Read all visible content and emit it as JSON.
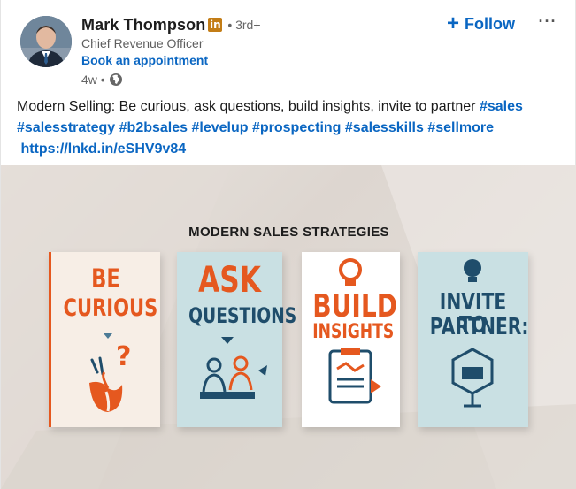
{
  "author": {
    "name": "Mark Thompson",
    "badge": "in",
    "degree": "• 3rd+",
    "headline": "Chief Revenue Officer",
    "cta": "Book an appointment",
    "timestamp": "4w •"
  },
  "actions": {
    "follow_label": "Follow",
    "follow_icon": "+",
    "more_icon": "···"
  },
  "post": {
    "text": "Modern Selling: Be curious, ask questions, build insights, invite to partner ",
    "hashtags": [
      "#sales",
      "#salesstrategy",
      "#b2bsales",
      "#levelup",
      "#prospecting",
      "#salesskills",
      "#sellmore"
    ],
    "link": "https://lnkd.in/eSHV9v84"
  },
  "image": {
    "title": "MODERN SALES STRATEGIES",
    "cards": [
      {
        "line1": "BE",
        "line2": "CURIOUS"
      },
      {
        "line1": "ASK",
        "line2": "QUESTIONS"
      },
      {
        "line1": "BUILD",
        "line2": "INSIGHTS"
      },
      {
        "line1": "INVITE TO",
        "line2": "PARTNER:"
      }
    ],
    "colors": {
      "orange": "#e5581f",
      "navy": "#1f4d6b",
      "card_light": "#f7eee6",
      "card_blue": "#c9e0e3"
    }
  }
}
